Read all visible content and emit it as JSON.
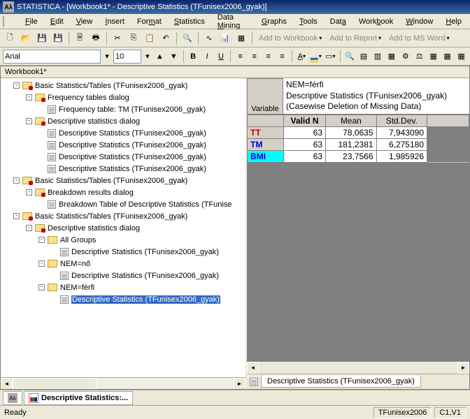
{
  "title": "STATISTICA - [Workbook1* - Descriptive Statistics (TFunisex2006_gyak)]",
  "menus": [
    "File",
    "Edit",
    "View",
    "Insert",
    "Format",
    "Statistics",
    "Data Mining",
    "Graphs",
    "Tools",
    "Data",
    "Workbook",
    "Window",
    "Help"
  ],
  "menu_underline_idx": [
    0,
    0,
    0,
    0,
    3,
    0,
    5,
    0,
    0,
    3,
    4,
    0,
    0
  ],
  "toolbar_text": {
    "add_workbook": "Add to Workbook",
    "add_report": "Add to Report",
    "add_word": "Add to MS Word"
  },
  "font": {
    "name": "Arial",
    "size": "10"
  },
  "doc_title": "Workbook1*",
  "tree": [
    {
      "depth": 0,
      "toggle": "-",
      "icon": "folder-red",
      "label": "Basic Statistics/Tables (TFunisex2006_gyak)"
    },
    {
      "depth": 1,
      "toggle": "-",
      "icon": "folder-red",
      "label": "Frequency tables dialog"
    },
    {
      "depth": 2,
      "toggle": "",
      "icon": "sheet",
      "label": "Frequency table: TM (TFunisex2006_gyak)"
    },
    {
      "depth": 1,
      "toggle": "-",
      "icon": "folder-red",
      "label": "Descriptive statistics dialog"
    },
    {
      "depth": 2,
      "toggle": "",
      "icon": "sheet",
      "label": "Descriptive Statistics (TFunisex2006_gyak)"
    },
    {
      "depth": 2,
      "toggle": "",
      "icon": "sheet",
      "label": "Descriptive Statistics (TFunisex2006_gyak)"
    },
    {
      "depth": 2,
      "toggle": "",
      "icon": "sheet",
      "label": "Descriptive Statistics (TFunisex2006_gyak)"
    },
    {
      "depth": 2,
      "toggle": "",
      "icon": "sheet",
      "label": "Descriptive Statistics (TFunisex2006_gyak)"
    },
    {
      "depth": 0,
      "toggle": "-",
      "icon": "folder-red",
      "label": "Basic Statistics/Tables (TFunisex2006_gyak)"
    },
    {
      "depth": 1,
      "toggle": "-",
      "icon": "folder-red",
      "label": "Breakdown results dialog"
    },
    {
      "depth": 2,
      "toggle": "",
      "icon": "sheet",
      "label": "Breakdown Table of Descriptive Statistics (TFunise"
    },
    {
      "depth": 0,
      "toggle": "-",
      "icon": "folder-red",
      "label": "Basic Statistics/Tables (TFunisex2006_gyak)"
    },
    {
      "depth": 1,
      "toggle": "-",
      "icon": "folder-red",
      "label": "Descriptive statistics dialog"
    },
    {
      "depth": 2,
      "toggle": "-",
      "icon": "folder",
      "label": "All Groups"
    },
    {
      "depth": 3,
      "toggle": "",
      "icon": "sheet",
      "label": "Descriptive Statistics (TFunisex2006_gyak)"
    },
    {
      "depth": 2,
      "toggle": "-",
      "icon": "folder",
      "label": "NEM=nő"
    },
    {
      "depth": 3,
      "toggle": "",
      "icon": "sheet",
      "label": "Descriptive Statistics (TFunisex2006_gyak)"
    },
    {
      "depth": 2,
      "toggle": "-",
      "icon": "folder",
      "label": "NEM=férfi"
    },
    {
      "depth": 3,
      "toggle": "",
      "icon": "sheet",
      "label": "Descriptive Statistics (TFunisex2006_gyak)",
      "selected": true
    }
  ],
  "grid": {
    "header_lines": [
      "NEM=férfi",
      "Descriptive Statistics (TFunisex2006_gyak)",
      "(Casewise Deletion of Missing Data)"
    ],
    "corner": "Variable",
    "columns": [
      "Valid N",
      "Mean",
      "Std.Dev."
    ],
    "rows": [
      {
        "name": "TT",
        "cls": "red",
        "values": [
          "63",
          "78,0635",
          "7,943090"
        ]
      },
      {
        "name": "TM",
        "cls": "blue",
        "values": [
          "63",
          "181,2381",
          "6,275180"
        ]
      },
      {
        "name": "BMI",
        "cls": "cyan",
        "values": [
          "63",
          "23,7566",
          "1,985926"
        ]
      }
    ]
  },
  "sheet_tab": "Descriptive Statistics (TFunisex2006_gyak)",
  "bottom_tabs": [
    "",
    "Descriptive Statistics:..."
  ],
  "status": {
    "left": "Ready",
    "dataset": "TFunisex2006",
    "cell": "C1,V1"
  }
}
